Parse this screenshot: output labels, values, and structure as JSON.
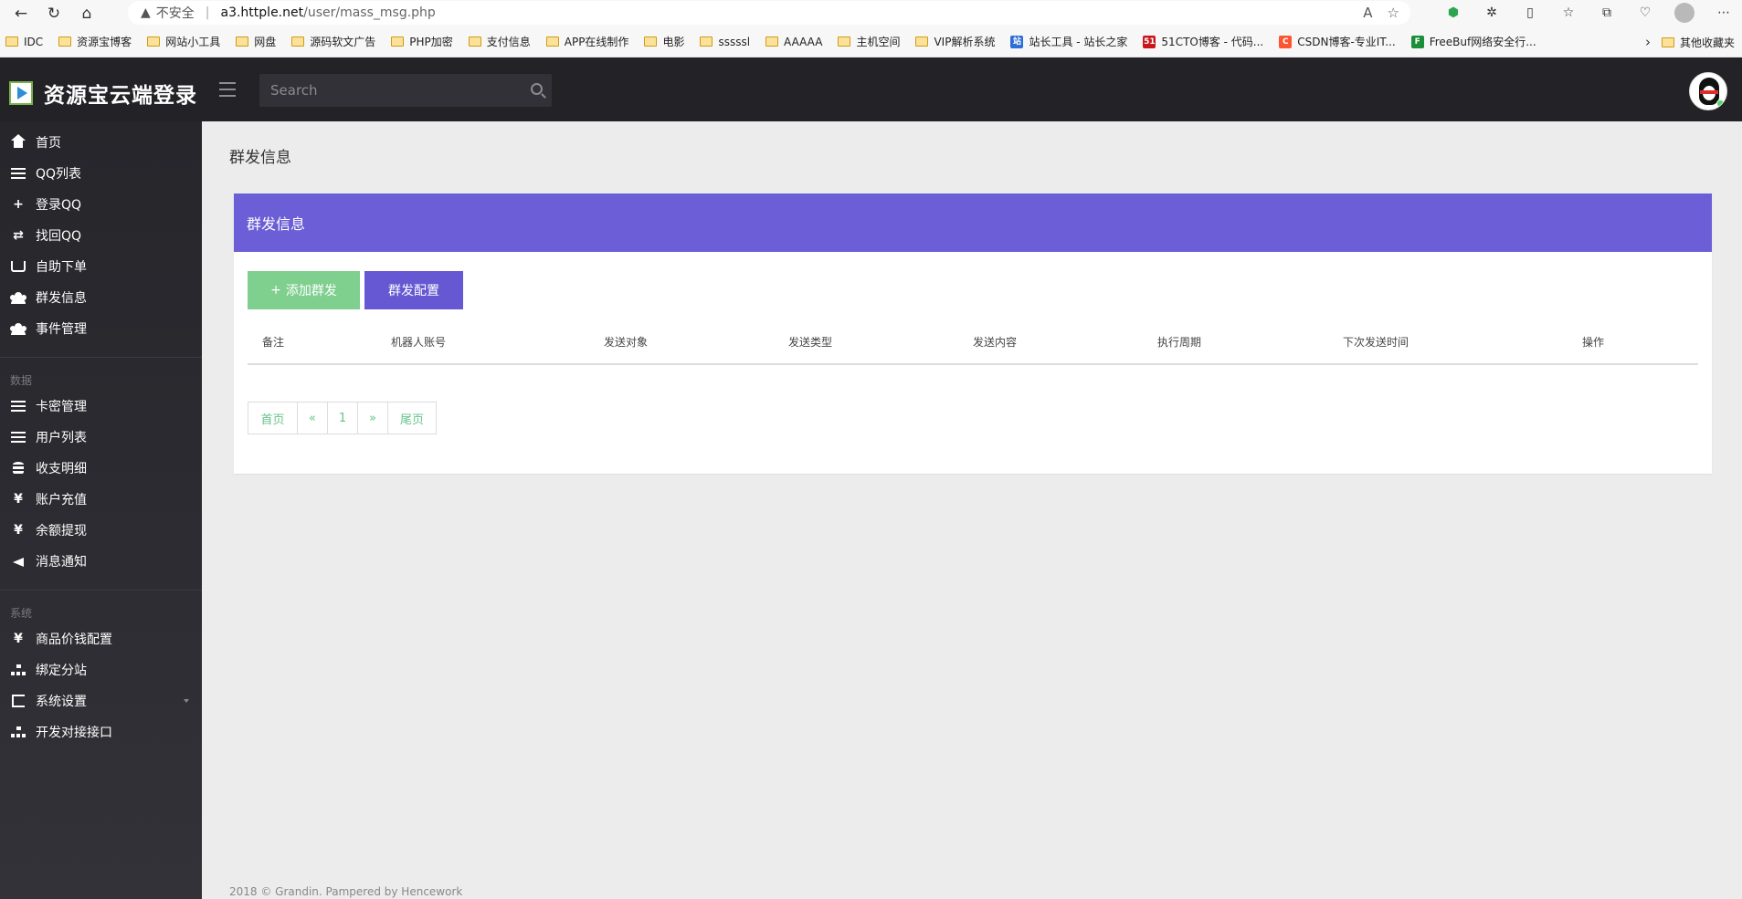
{
  "browser": {
    "security_label": "不安全",
    "url_host": "a3.httple.net",
    "url_path": "/user/mass_msg.php",
    "bookmarks": [
      "IDC",
      "资源宝博客",
      "网站小工具",
      "网盘",
      "源码软文广告",
      "PHP加密",
      "支付信息",
      "APP在线制作",
      "电影",
      "sssssl",
      "AAAAA",
      "主机空间",
      "VIP解析系统",
      "站长工具 - 站长之家",
      "51CTO博客 - 代码...",
      "CSDN博客-专业IT...",
      "FreeBuf网络安全行..."
    ],
    "other_bookmarks": "其他收藏夹"
  },
  "header": {
    "brand": "资源宝云端登录",
    "search_placeholder": "Search"
  },
  "sidebar": {
    "main_items": [
      "首页",
      "QQ列表",
      "登录QQ",
      "找回QQ",
      "自助下单",
      "群发信息",
      "事件管理"
    ],
    "data_title": "数据",
    "data_items": [
      "卡密管理",
      "用户列表",
      "收支明细",
      "账户充值",
      "余额提现",
      "消息通知"
    ],
    "system_title": "系统",
    "system_items": [
      "商品价钱配置",
      "绑定分站",
      "系统设置",
      "开发对接接口"
    ]
  },
  "main": {
    "page_title": "群发信息",
    "card_title": "群发信息",
    "add_button": "添加群发",
    "config_button": "群发配置",
    "columns": [
      "备注",
      "机器人账号",
      "发送对象",
      "发送类型",
      "发送内容",
      "执行周期",
      "下次发送时间",
      "操作"
    ],
    "pager": [
      "首页",
      "«",
      "1",
      "»",
      "尾页"
    ]
  },
  "footer": "2018 © Grandin. Pampered by Hencework",
  "colors": {
    "accent": "#6b5ed6",
    "success": "#7fcf8f",
    "sidebar_bg": "#26262b"
  }
}
